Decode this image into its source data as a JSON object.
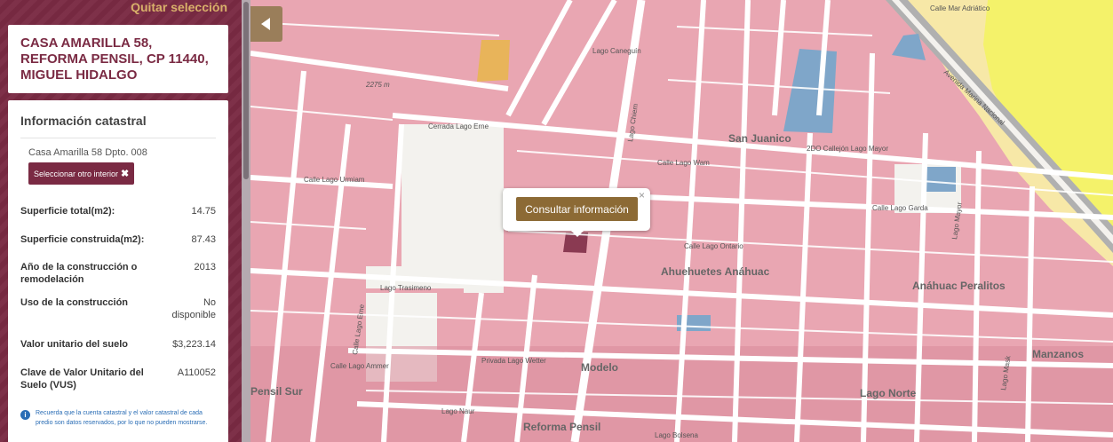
{
  "sidebar": {
    "clear_selection": "Quitar selección",
    "address": [
      "CASA AMARILLA 58,",
      "REFORMA PENSIL, CP 11440,",
      "MIGUEL HIDALGO"
    ],
    "info_title": "Información catastral",
    "interior_label": "Casa Amarilla 58 Dpto. 008",
    "select_interior_label": "Seleccionar otro interior",
    "select_interior_icon": "close-x-icon",
    "fields": [
      {
        "label": "Superficie total(m2):",
        "value": "14.75"
      },
      {
        "label": "Superficie construida(m2):",
        "value": "87.43"
      },
      {
        "label": "Año de la construcción o remodelación",
        "value": "2013"
      },
      {
        "label": "Uso de la construcción",
        "value": "No disponible"
      },
      {
        "label": "Valor unitario del suelo",
        "value": "$3,223.14"
      },
      {
        "label": "Clave de Valor Unitario del Suelo (VUS)",
        "value": "A110052"
      }
    ],
    "notice_icon": "info-icon",
    "notice": "Recuerda que la cuenta catastral y el valor catastral de cada predio son datos reservados, por lo que no pueden mostrarse."
  },
  "map": {
    "toggle_icon": "chevron-left-icon",
    "popup": {
      "button_label": "Consultar información",
      "close": "×"
    },
    "colors": {
      "block": "#e9a6b2",
      "park": "#f3f2ee",
      "water": "#7fa6c9",
      "commercial": "#f4f26a",
      "orange": "#e8b45a",
      "selected": "#8a3a52"
    },
    "scale_label": "2275 m",
    "neighborhoods": [
      "San Juanico",
      "Ahuehuetes Anáhuac",
      "Anáhuac Peralitos",
      "Modelo",
      "Manzanos",
      "Lago Norte",
      "Reforma Pensil",
      "Pensil Sur"
    ],
    "streets": [
      "Calle Mar Adriático",
      "Avenida Marina Nacional",
      "Calle Lago Garda",
      "Lago Trasimeno",
      "Privada Lago Wetter",
      "Lago Naur",
      "Lago Bolsena",
      "Cerrada Lago Erne",
      "Calle Lago Urmiam",
      "Lago Caneguín",
      "Lago Chiem",
      "Calle Lago Wam",
      "2DO Callejón Lago Mayor",
      "Calle Lago Ammer",
      "Calle Lago Erne",
      "Lago Mayor",
      "Lago Mask",
      "Calle Lago Ontario"
    ]
  }
}
